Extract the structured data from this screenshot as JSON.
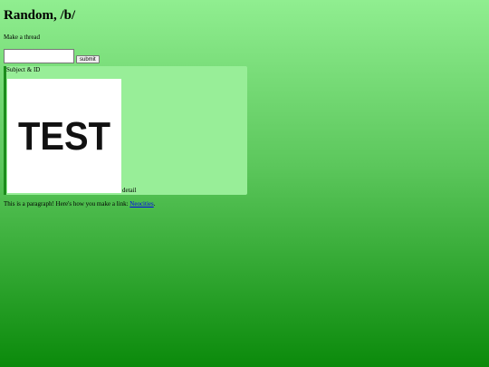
{
  "header": {
    "title": "Random, /b/"
  },
  "form": {
    "label": "Make a thread",
    "input_value": "",
    "submit_label": "submit"
  },
  "post": {
    "subject": "Subject & ID",
    "image_text": "TEST",
    "detail_label": "detail"
  },
  "footer": {
    "paragraph_text": "This is a paragraph! Here's how you make a link: ",
    "link_text": "Neocities",
    "after_link": "."
  },
  "colors": {
    "gradient_top": "#90ee90",
    "gradient_bottom": "#0b8a0b",
    "post_background": "#98ee98",
    "post_border": "#1c8c1c",
    "link": "#0000ee"
  }
}
